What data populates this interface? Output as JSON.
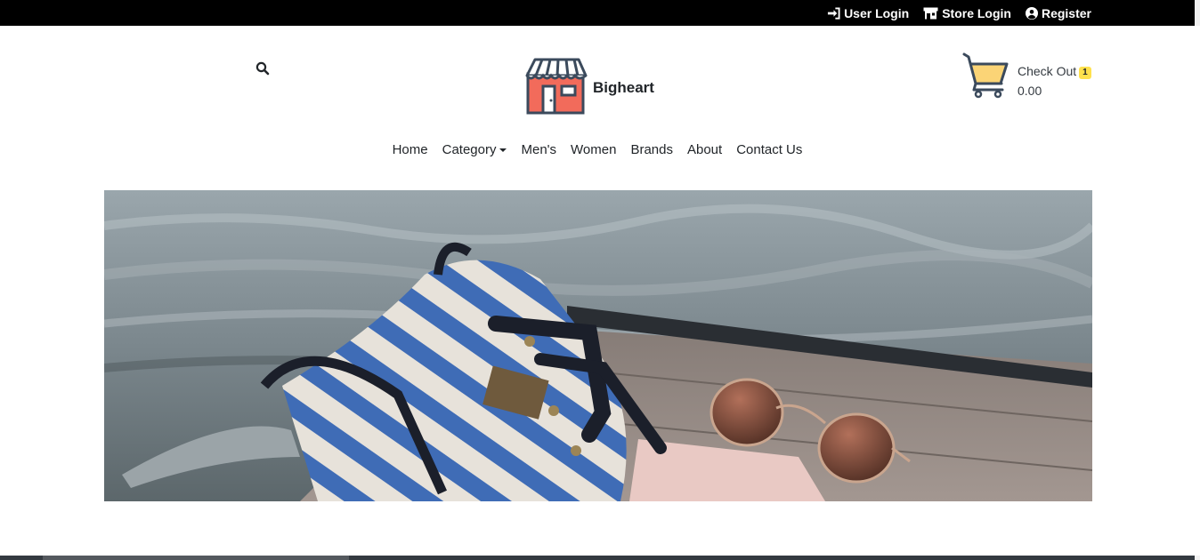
{
  "topbar": {
    "links": [
      {
        "label": "User Login",
        "icon": "sign-in-icon"
      },
      {
        "label": "Store Login",
        "icon": "store-icon"
      },
      {
        "label": "Register",
        "icon": "user-circle-icon"
      }
    ]
  },
  "header": {
    "search_icon": "search-icon",
    "brand": {
      "name": "Bigheart",
      "logo_icon": "shop-storefront-icon"
    },
    "cart": {
      "label": "Check Out",
      "count": "1",
      "total": "0.00",
      "icon": "shopping-cart-icon"
    }
  },
  "nav": {
    "items": [
      {
        "label": "Home"
      },
      {
        "label": "Category",
        "dropdown": true
      },
      {
        "label": "Men's"
      },
      {
        "label": "Women"
      },
      {
        "label": "Brands"
      },
      {
        "label": "About"
      },
      {
        "label": "Contact Us"
      }
    ]
  },
  "hero": {
    "image": "striped-bag-and-sunglasses-on-dock-photo"
  },
  "colors": {
    "topbar_bg": "#000000",
    "text": "#212529",
    "badge": "#ffe14d",
    "logo_awning": "#f26b5b",
    "logo_outline": "#3b4a5c"
  }
}
